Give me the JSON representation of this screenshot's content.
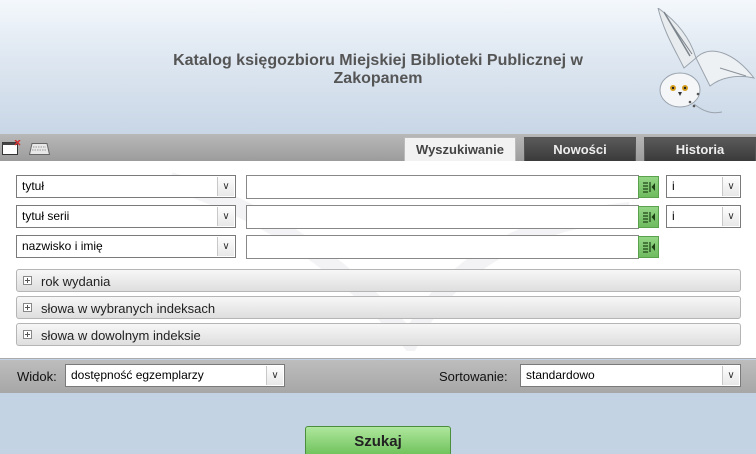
{
  "header": {
    "title_line1": "Katalog księgozbioru Miejskiej Biblioteki Publicznej w",
    "title_line2": "Zakopanem",
    "logo_icon": "snowy-owl-icon"
  },
  "toolbar": {
    "icons": [
      "new-window-icon",
      "keyboard-icon"
    ]
  },
  "tabs": [
    {
      "label": "Wyszukiwanie",
      "active": true
    },
    {
      "label": "Nowości",
      "active": false
    },
    {
      "label": "Historia",
      "active": false
    }
  ],
  "search_rows": [
    {
      "field": "tytuł",
      "value": "",
      "operator": "i"
    },
    {
      "field": "tytuł serii",
      "value": "",
      "operator": "i"
    },
    {
      "field": "nazwisko i imię",
      "value": ""
    }
  ],
  "sections": [
    {
      "label": "rok wydania"
    },
    {
      "label": "słowa w wybranych indeksach"
    },
    {
      "label": "słowa w dowolnym indeksie"
    }
  ],
  "options": {
    "view_label": "Widok:",
    "view_value": "dostępność egzemplarzy",
    "sort_label": "Sortowanie:",
    "sort_value": "standardowo"
  },
  "search_button": "Szukaj",
  "colors": {
    "accent_green": "#7ccb69",
    "tab_active": "#f2f2f2",
    "tab_inactive": "#4a4a4a"
  }
}
